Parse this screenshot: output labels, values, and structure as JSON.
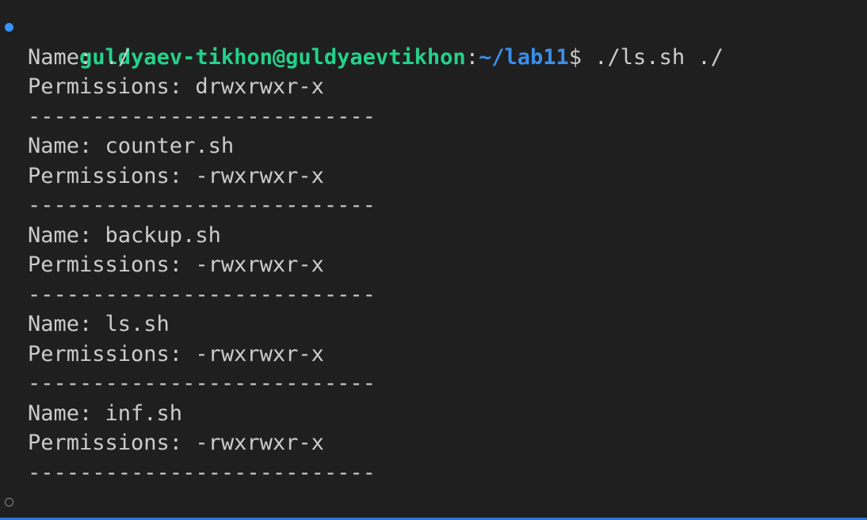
{
  "prompt": {
    "user_host": "guldyaev-tikhon@guldyaevtikhon",
    "colon": ":",
    "path": "~/lab11",
    "dollar": "$",
    "command": " ./ls.sh ./"
  },
  "output": [
    {
      "name_line": "Name: ./",
      "perm_line": "Permissions: drwxrwxr-x",
      "separator": "---------------------------"
    },
    {
      "name_line": "Name: counter.sh",
      "perm_line": "Permissions: -rwxrwxr-x",
      "separator": "---------------------------"
    },
    {
      "name_line": "Name: backup.sh",
      "perm_line": "Permissions: -rwxrwxr-x",
      "separator": "---------------------------"
    },
    {
      "name_line": "Name: ls.sh",
      "perm_line": "Permissions: -rwxrwxr-x",
      "separator": "---------------------------"
    },
    {
      "name_line": "Name: inf.sh",
      "perm_line": "Permissions: -rwxrwxr-x",
      "separator": "---------------------------"
    }
  ],
  "colors": {
    "background": "#1f1f1f",
    "user_host": "#23d18b",
    "path": "#3b8eea",
    "decoration_success": "#3794ff",
    "focus_border": "#2b79d8"
  }
}
